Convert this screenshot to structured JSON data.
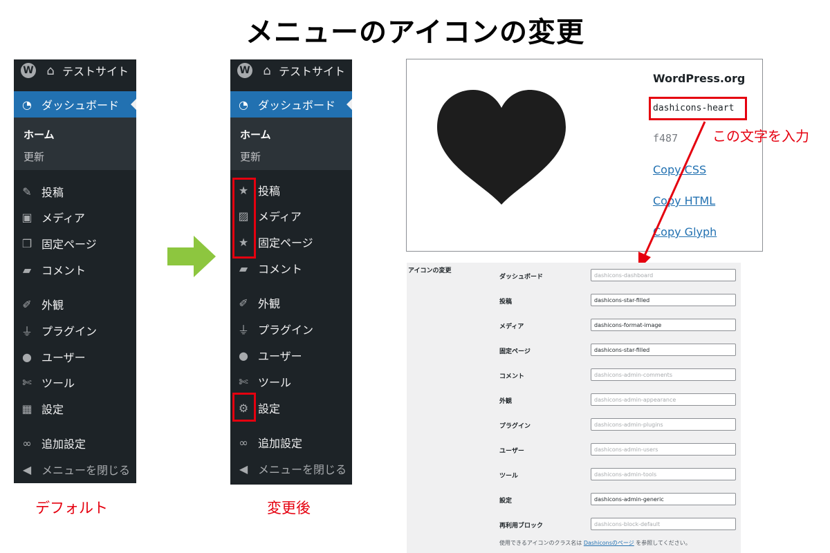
{
  "title": "メニューのアイコンの変更",
  "sidebar": {
    "site_name": "テストサイト",
    "dashboard": "ダッシュボード",
    "sub_home": "ホーム",
    "sub_updates": "更新",
    "items": [
      "投稿",
      "メディア",
      "固定ページ",
      "コメント",
      "外観",
      "プラグイン",
      "ユーザー",
      "ツール",
      "設定",
      "追加設定",
      "メニューを閉じる"
    ]
  },
  "captions": {
    "default": "デフォルト",
    "after": "変更後"
  },
  "dashicon": {
    "brand": "WordPress.org",
    "class_name": "dashicons-heart",
    "code": "f487",
    "links": [
      "Copy CSS",
      "Copy HTML",
      "Copy Glyph"
    ],
    "instruction": "この文字を入力"
  },
  "settings": {
    "title": "アイコンの変更",
    "rows": [
      {
        "label": "ダッシュボード",
        "value": "",
        "placeholder": "dashicons-dashboard"
      },
      {
        "label": "投稿",
        "value": "dashicons-star-filled",
        "placeholder": ""
      },
      {
        "label": "メディア",
        "value": "dashicons-format-image",
        "placeholder": ""
      },
      {
        "label": "固定ページ",
        "value": "dashicons-star-filled",
        "placeholder": ""
      },
      {
        "label": "コメント",
        "value": "",
        "placeholder": "dashicons-admin-comments"
      },
      {
        "label": "外観",
        "value": "",
        "placeholder": "dashicons-admin-appearance"
      },
      {
        "label": "プラグイン",
        "value": "",
        "placeholder": "dashicons-admin-plugins"
      },
      {
        "label": "ユーザー",
        "value": "",
        "placeholder": "dashicons-admin-users"
      },
      {
        "label": "ツール",
        "value": "",
        "placeholder": "dashicons-admin-tools"
      },
      {
        "label": "設定",
        "value": "dashicons-admin-generic",
        "placeholder": ""
      },
      {
        "label": "再利用ブロック",
        "value": "",
        "placeholder": "dashicons-block-default"
      }
    ],
    "note_before": "使用できるアイコンのクラス名は",
    "note_link": "Dashiconsのページ",
    "note_after": "を参照してください。"
  },
  "colors": {
    "sidebar_bg": "#1d2327",
    "active": "#2271b1",
    "highlight": "#e5000f",
    "arrow": "#8dc63f"
  }
}
